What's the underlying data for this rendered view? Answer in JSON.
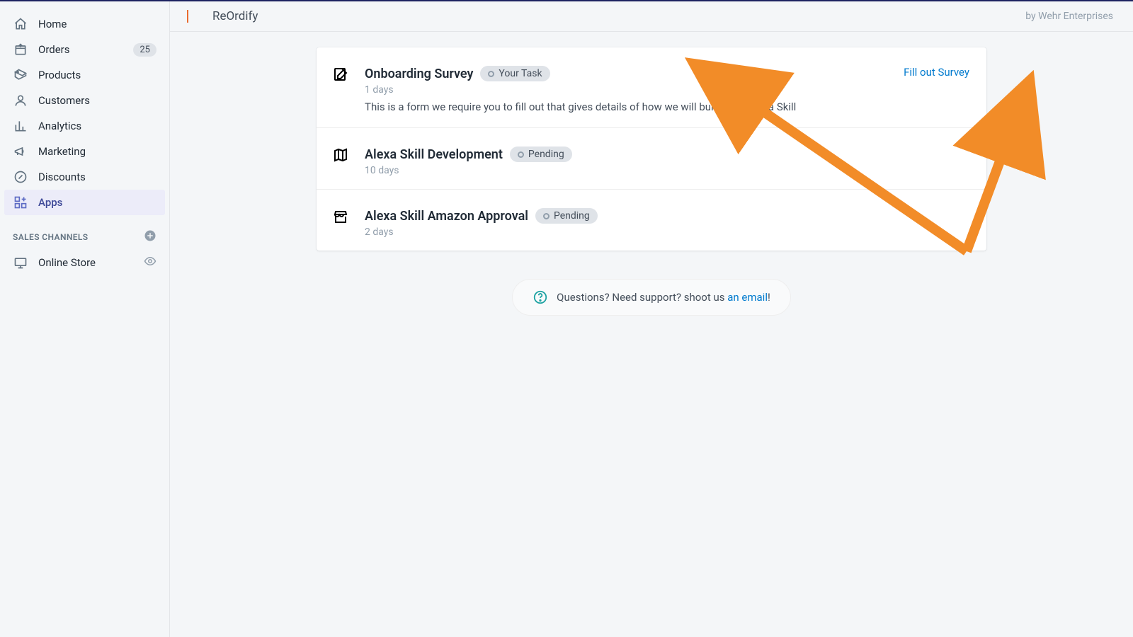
{
  "sidebar": {
    "items": [
      {
        "label": "Home"
      },
      {
        "label": "Orders",
        "badge": "25"
      },
      {
        "label": "Products"
      },
      {
        "label": "Customers"
      },
      {
        "label": "Analytics"
      },
      {
        "label": "Marketing"
      },
      {
        "label": "Discounts"
      },
      {
        "label": "Apps"
      }
    ],
    "channels_heading": "SALES CHANNELS",
    "channels": [
      {
        "label": "Online Store"
      }
    ]
  },
  "topbar": {
    "app_name": "ReOrdify",
    "byline": "by Wehr Enterprises"
  },
  "tasks": [
    {
      "title": "Onboarding Survey",
      "badge": "Your Task",
      "duration": "1 days",
      "desc": "This is a form we require you to fill out that gives details of how we will build your Alexa Skill",
      "action": "Fill out Survey"
    },
    {
      "title": "Alexa Skill Development",
      "badge": "Pending",
      "duration": "10 days"
    },
    {
      "title": "Alexa Skill Amazon Approval",
      "badge": "Pending",
      "duration": "2 days"
    }
  ],
  "support": {
    "text_a": "Questions? Need support? shoot us ",
    "link": "an email",
    "text_b": "!"
  }
}
